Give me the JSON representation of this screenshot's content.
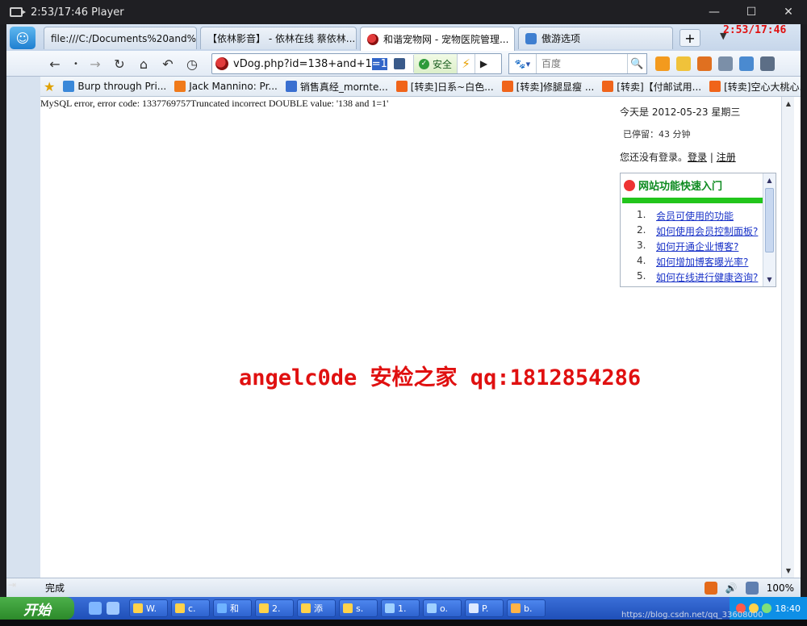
{
  "player": {
    "title": "2:53/17:46 Player",
    "controls": [
      "—",
      "☐",
      "✕"
    ]
  },
  "tabs": [
    {
      "label": "file:///C:/Documents%20and%20...",
      "icon": "file-icon"
    },
    {
      "label": "【依林影音】 - 依林在线 蔡依林...",
      "icon": "page-icon"
    },
    {
      "label": "和谐宠物网 - 宠物医院管理...",
      "icon": "pet-site-icon",
      "active": true
    },
    {
      "label": "傲游选项",
      "icon": "maxthon-options-icon"
    }
  ],
  "tab_close": "✕",
  "new_tab": "+",
  "overlay_time": "2:53/17:46",
  "navbar": {
    "url": "vDog.php?id=138+and+1",
    "url_selected": "=1",
    "secure_label": "安全",
    "search_engine": "百度",
    "search_placeholder": "百度"
  },
  "bookmarks": [
    {
      "label": "Burp through Pri...",
      "color": "#3a88d9"
    },
    {
      "label": "Jack Mannino: Pr...",
      "color": "#f07a1a"
    },
    {
      "label": "销售真经_mornte...",
      "color": "#3a6fd0"
    },
    {
      "label": "[转卖]日系~白色...",
      "color": "#f0641a"
    },
    {
      "label": "[转卖]修腿显瘦 ...",
      "color": "#f0641a"
    },
    {
      "label": "[转卖]【付邮试用...",
      "color": "#f0641a"
    },
    {
      "label": "[转卖]空心大桃心...",
      "color": "#f0641a"
    }
  ],
  "bookmarks_more": "»",
  "page": {
    "mysql_error": "MySQL error, error code: 1337769757Truncated incorrect DOUBLE value: '138 and 1=1'",
    "date_line": "今天是 2012-05-23 星期三",
    "stay_line": "已停留：43 分钟",
    "login_prefix": "您还没有登录。",
    "login_link": "登录",
    "login_sep": " | ",
    "register_link": "注册",
    "quick_title": "网站功能快速入门",
    "quick_items": [
      {
        "num": "1.",
        "label": "会员可使用的功能"
      },
      {
        "num": "2.",
        "label": "如何使用会员控制面板?"
      },
      {
        "num": "3.",
        "label": "如何开通企业博客?"
      },
      {
        "num": "4.",
        "label": "如何增加博客曝光率?"
      },
      {
        "num": "5.",
        "label": "如何在线进行健康咨询?"
      }
    ],
    "watermark": "angelc0de 安检之家 qq:1812854286"
  },
  "status": {
    "text": "完成",
    "zoom": "100%"
  },
  "taskbar": {
    "start_label": "开始",
    "items": [
      "W.",
      "c.",
      "和",
      "2.",
      "添",
      "s.",
      "1.",
      "o.",
      "P.",
      "b."
    ],
    "clock": "18:40"
  },
  "watermark_url": "https://blog.csdn.net/qq_33608000"
}
